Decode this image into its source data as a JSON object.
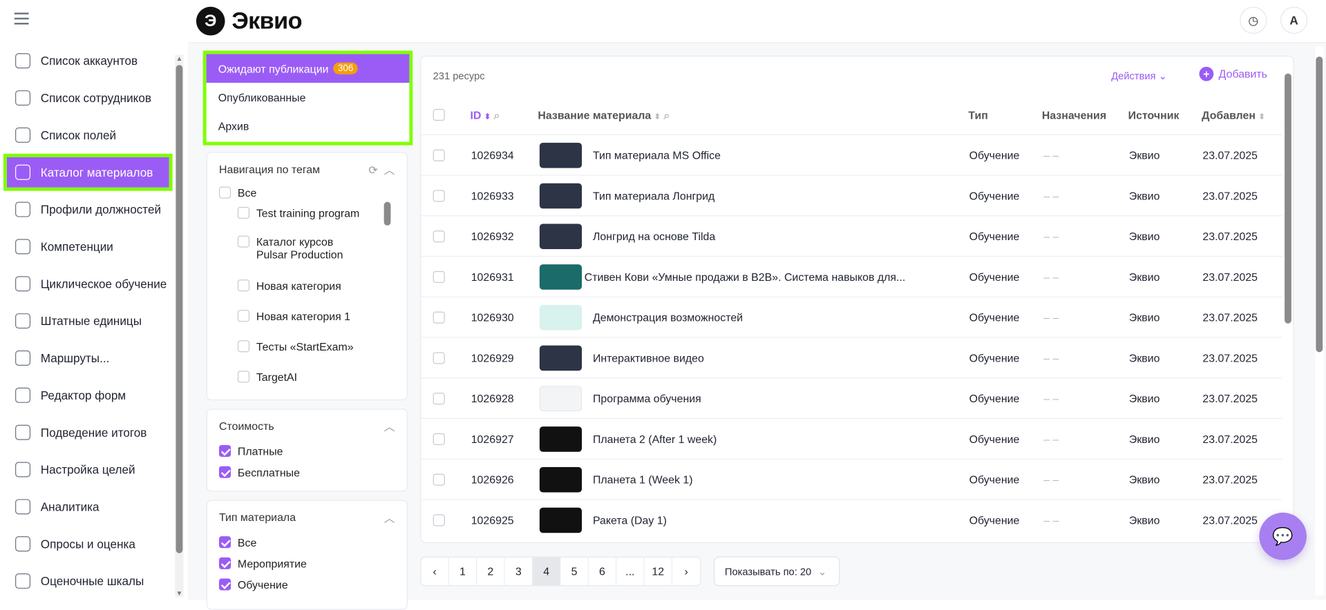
{
  "header": {
    "logo_text": "Эквио",
    "logo_mark": "Э",
    "avatar": "A",
    "history_icon": "history-icon"
  },
  "sidebar": {
    "items": [
      {
        "label": "Список аккаунтов"
      },
      {
        "label": "Список сотрудников"
      },
      {
        "label": "Список полей"
      },
      {
        "label": "Каталог материалов",
        "active": true
      },
      {
        "label": "Профили должностей"
      },
      {
        "label": "Компетенции"
      },
      {
        "label": "Циклическое обучение"
      },
      {
        "label": "Штатные единицы"
      },
      {
        "label": "Маршруты..."
      },
      {
        "label": "Редактор форм"
      },
      {
        "label": "Подведение итогов"
      },
      {
        "label": "Настройка целей"
      },
      {
        "label": "Аналитика"
      },
      {
        "label": "Опросы и оценка"
      },
      {
        "label": "Оценочные шкалы"
      }
    ]
  },
  "status_tabs": [
    {
      "label": "Ожидают публикации",
      "badge": "306",
      "active": true
    },
    {
      "label": "Опубликованные"
    },
    {
      "label": "Архив"
    }
  ],
  "tags": {
    "title": "Навигация по тегам",
    "all": "Все",
    "items": [
      "Test training program",
      "Каталог курсов Pulsar Production",
      "Новая категория",
      "Новая категория 1",
      "Тесты «StartExam»",
      "TargetAI"
    ]
  },
  "cost": {
    "title": "Стоимость",
    "items": [
      {
        "label": "Платные",
        "checked": true
      },
      {
        "label": "Бесплатные",
        "checked": true
      }
    ]
  },
  "material_type": {
    "title": "Тип материала",
    "items": [
      {
        "label": "Все",
        "checked": true
      },
      {
        "label": "Мероприятие",
        "checked": true
      },
      {
        "label": "Обучение",
        "checked": true
      }
    ]
  },
  "table": {
    "count": "231 ресурс",
    "actions": "Действия",
    "add": "Добавить",
    "columns": {
      "id": "ID",
      "name": "Название материала",
      "type": "Тип",
      "assign": "Назначения",
      "source": "Источник",
      "added": "Добавлен"
    },
    "rows": [
      {
        "id": "1026934",
        "name": "Тип материала MS Office",
        "type": "Обучение",
        "assign": "– –",
        "source": "Эквио",
        "added": "23.07.2025"
      },
      {
        "id": "1026933",
        "name": "Тип материала Лонгрид",
        "type": "Обучение",
        "assign": "– –",
        "source": "Эквио",
        "added": "23.07.2025"
      },
      {
        "id": "1026932",
        "name": "Лонгрид на основе Tilda",
        "type": "Обучение",
        "assign": "– –",
        "source": "Эквио",
        "added": "23.07.2025"
      },
      {
        "id": "1026931",
        "name": "Стивен Кови «Умные продажи в B2B». Система навыков для...",
        "type": "Обучение",
        "assign": "– –",
        "source": "Эквио",
        "added": "23.07.2025"
      },
      {
        "id": "1026930",
        "name": "Демонстрация возможностей",
        "type": "Обучение",
        "assign": "– –",
        "source": "Эквио",
        "added": "23.07.2025"
      },
      {
        "id": "1026929",
        "name": "Интерактивное видео",
        "type": "Обучение",
        "assign": "– –",
        "source": "Эквио",
        "added": "23.07.2025"
      },
      {
        "id": "1026928",
        "name": "Программа обучения",
        "type": "Обучение",
        "assign": "– –",
        "source": "Эквио",
        "added": "23.07.2025"
      },
      {
        "id": "1026927",
        "name": "Планета 2 (After 1 week)",
        "type": "Обучение",
        "assign": "– –",
        "source": "Эквио",
        "added": "23.07.2025"
      },
      {
        "id": "1026926",
        "name": "Планета 1 (Week 1)",
        "type": "Обучение",
        "assign": "– –",
        "source": "Эквио",
        "added": "23.07.2025"
      },
      {
        "id": "1026925",
        "name": "Ракета (Day 1)",
        "type": "Обучение",
        "assign": "– –",
        "source": "Эквио",
        "added": "23.07.2025"
      }
    ]
  },
  "pagination": {
    "prev": "‹",
    "next": "›",
    "pages": [
      "1",
      "2",
      "3",
      "4",
      "5",
      "6",
      "...",
      "12"
    ],
    "current": "4",
    "page_size": "Показывать по: 20"
  },
  "colors": {
    "accent": "#9b5cf6",
    "highlight": "#7fff00",
    "badge": "#f59e0b"
  }
}
